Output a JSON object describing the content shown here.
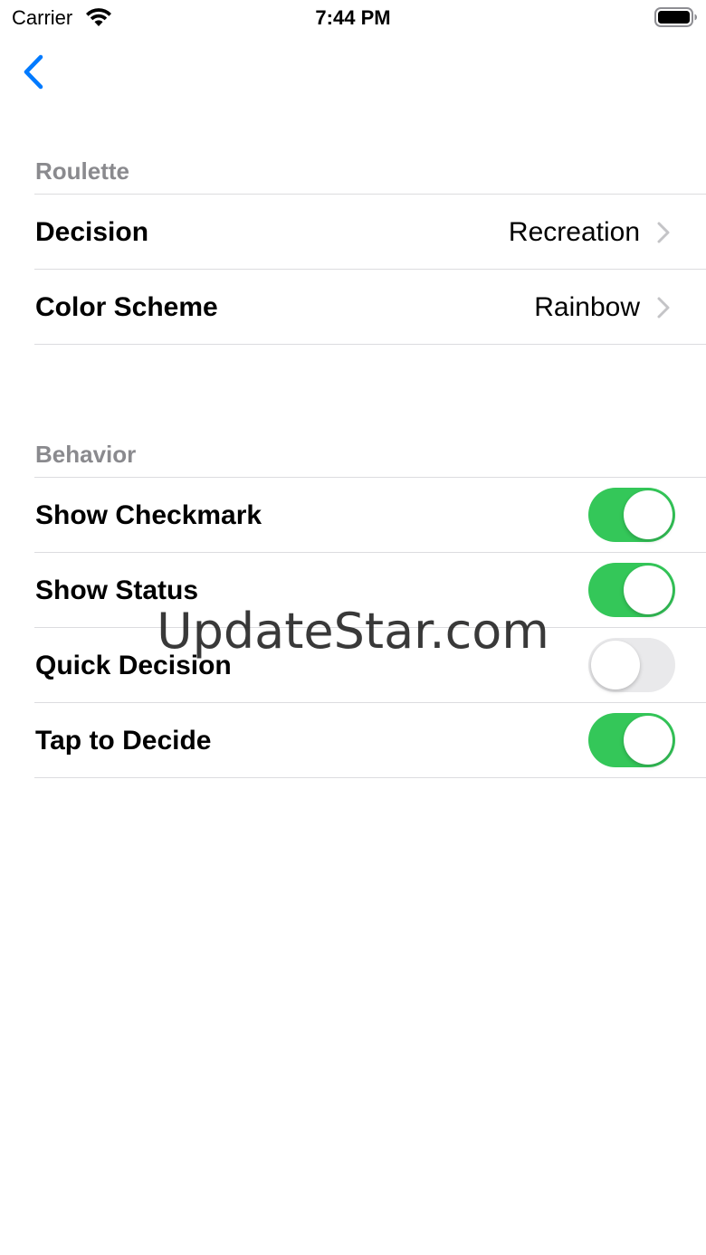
{
  "status_bar": {
    "carrier": "Carrier",
    "time": "7:44 PM"
  },
  "nav": {
    "back_icon": "chevron-left-icon",
    "accent_color": "#007aff"
  },
  "sections": {
    "roulette": {
      "header": "Roulette",
      "rows": [
        {
          "label": "Decision",
          "value": "Recreation"
        },
        {
          "label": "Color Scheme",
          "value": "Rainbow"
        }
      ]
    },
    "behavior": {
      "header": "Behavior",
      "rows": [
        {
          "label": "Show Checkmark",
          "on": true
        },
        {
          "label": "Show Status",
          "on": true
        },
        {
          "label": "Quick Decision",
          "on": false
        },
        {
          "label": "Tap to Decide",
          "on": true
        }
      ]
    }
  },
  "colors": {
    "toggle_on": "#34c759",
    "toggle_off": "#e9e9eb",
    "section_header": "#8a8a8e"
  },
  "watermark": "UpdateStar.com"
}
